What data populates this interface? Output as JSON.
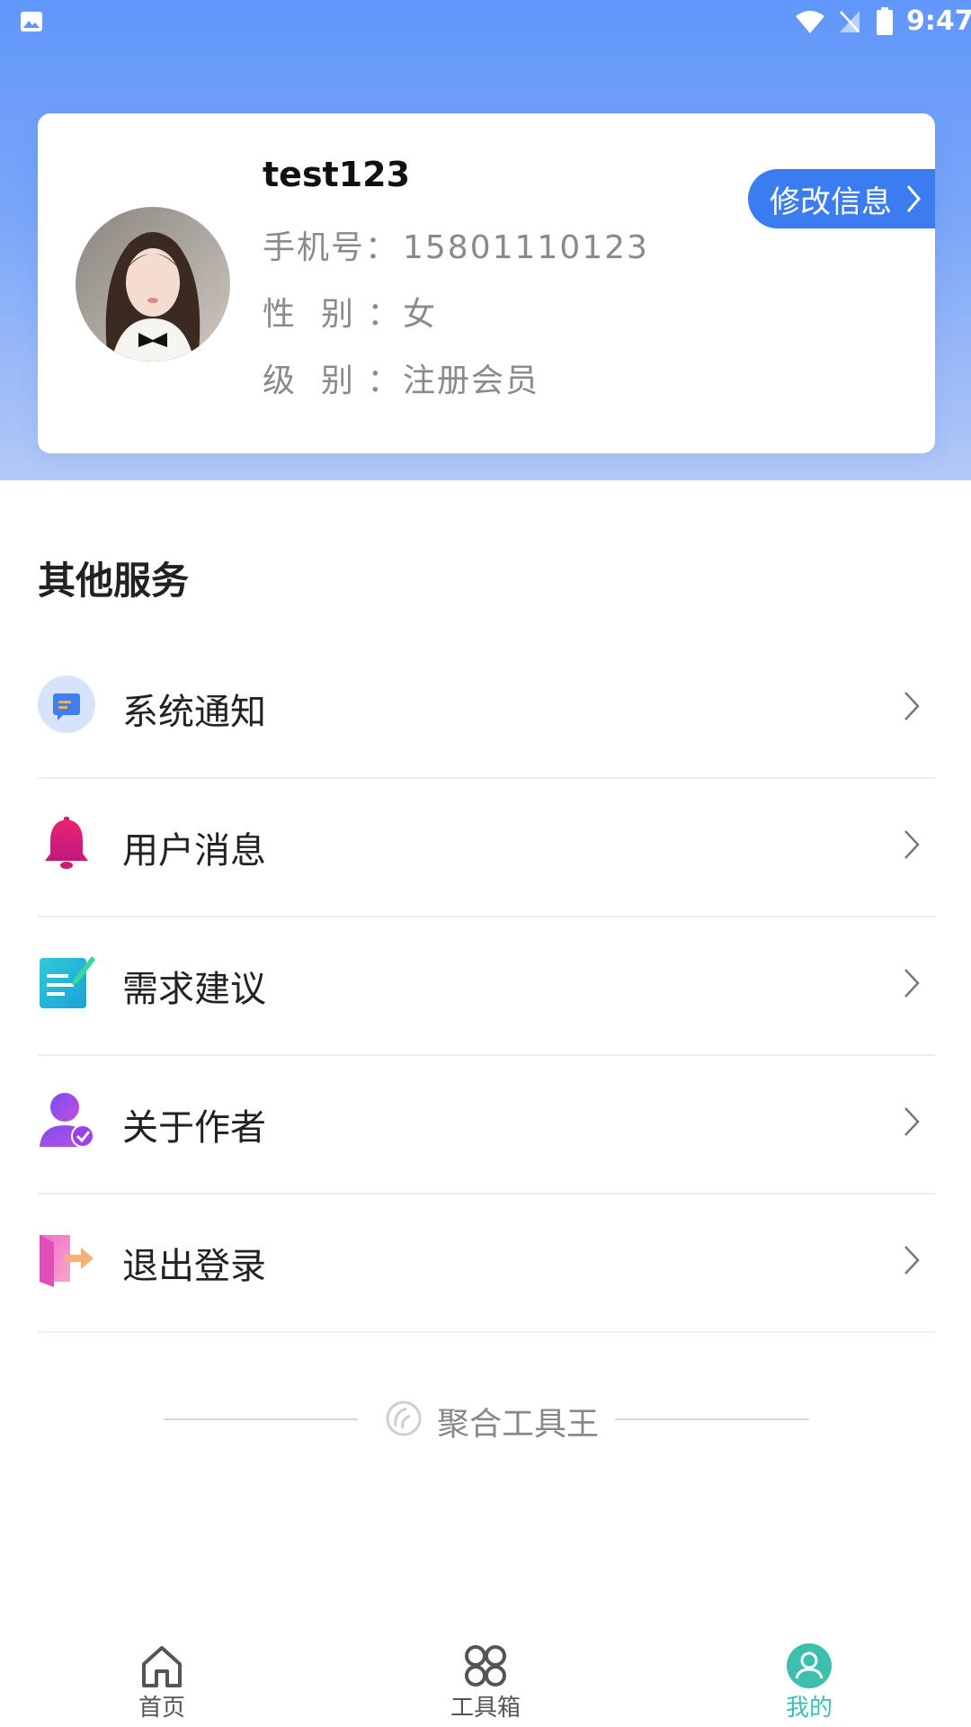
{
  "status_bar": {
    "time": "9:47"
  },
  "profile": {
    "username": "test123",
    "phone_label": "手机号：",
    "phone": "15801110123",
    "gender_label": "性  别 ：",
    "gender": "女",
    "level_label": "级  别 ：",
    "level": "注册会员",
    "edit_button": "修改信息"
  },
  "services": {
    "title": "其他服务",
    "items": [
      {
        "label": "系统通知",
        "icon": "notification-icon"
      },
      {
        "label": "用户消息",
        "icon": "bell-icon"
      },
      {
        "label": "需求建议",
        "icon": "edit-note-icon"
      },
      {
        "label": "关于作者",
        "icon": "user-verified-icon"
      },
      {
        "label": "退出登录",
        "icon": "logout-icon"
      }
    ]
  },
  "footer": {
    "brand": "聚合工具王"
  },
  "tabs": [
    {
      "label": "首页",
      "icon": "home-icon",
      "active": false
    },
    {
      "label": "工具箱",
      "icon": "toolbox-icon",
      "active": false
    },
    {
      "label": "我的",
      "icon": "profile-icon",
      "active": true
    }
  ],
  "colors": {
    "primary": "#3b7cf0",
    "header": "#6197fb",
    "tab_active": "#3ebfae"
  }
}
